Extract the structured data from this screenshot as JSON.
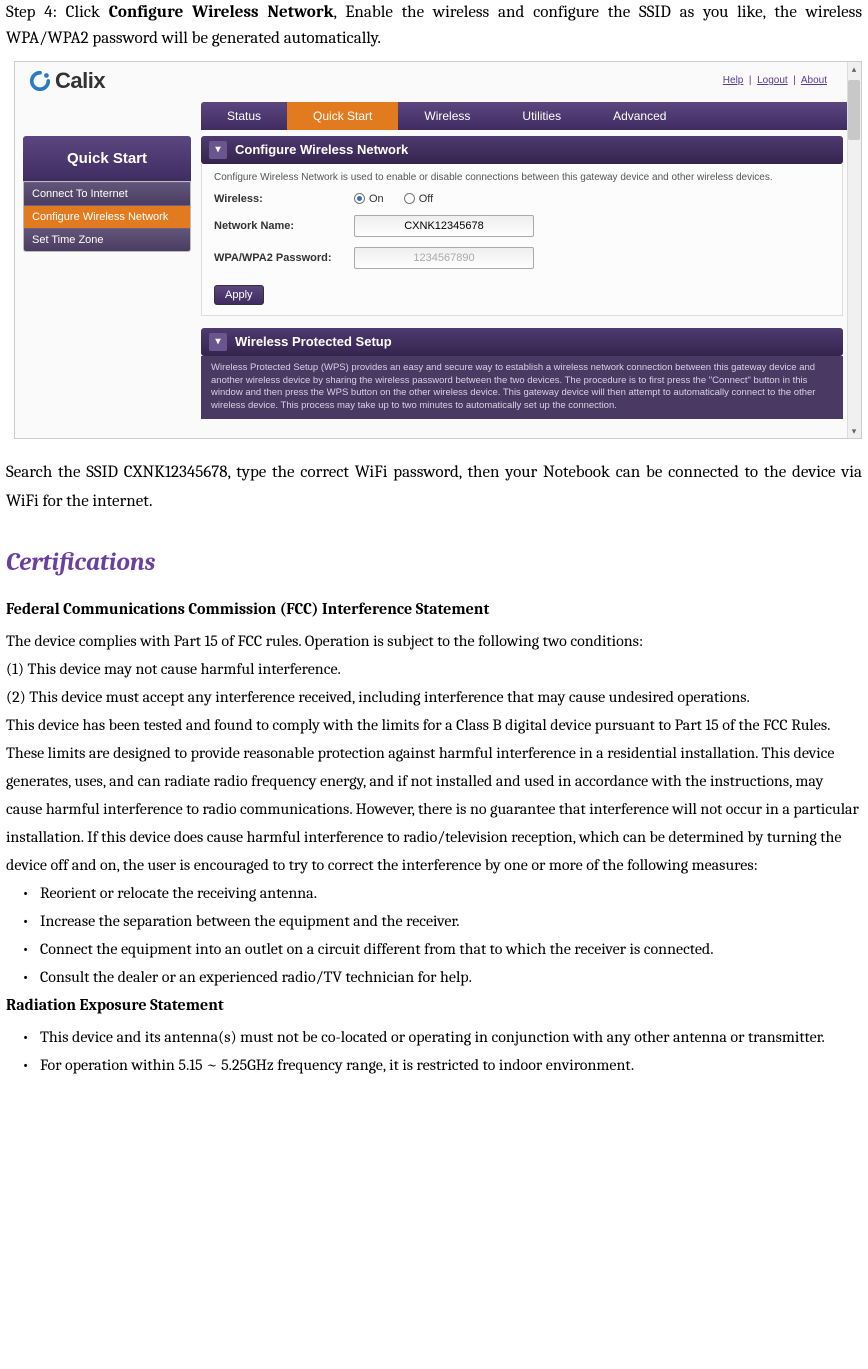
{
  "doc": {
    "step_prefix": "Step 4: Click ",
    "step_bold": "Configure Wireless Network",
    "step_suffix": ", Enable the wireless and configure the SSID as you like, the wireless WPA/WPA2 password will be generated automatically.",
    "after_screenshot": "Search the SSID CXNK12345678, type the correct WiFi password, then your Notebook can be connected to the device via WiFi for the internet.",
    "section_title": "Certifications",
    "fcc_title": "Federal Communications Commission (FCC) Interference Statement",
    "fcc_intro": "The device complies with Part 15 of FCC rules. Operation is subject to the following two conditions:",
    "fcc_cond1": "(1) This device may not cause harmful interference.",
    "fcc_cond2": "(2) This device must accept any interference received, including interference that may cause undesired operations.",
    "fcc_body": "This device has been tested and found to comply with the limits for a Class B digital device pursuant to Part 15 of the FCC Rules. These limits are designed to provide reasonable protection against harmful interference in a residential installation. This device generates, uses, and can radiate radio frequency energy, and if not installed and used in accordance with the instructions, may cause harmful interference to radio communications. However, there is no guarantee that interference will not occur in a particular installation. If this device does cause harmful interference to radio/television reception, which can be determined by turning the device off and on, the user is encouraged to try to correct the interference by one or more of the following measures:",
    "bullets": [
      "Reorient or relocate the receiving antenna.",
      "Increase the separation between the equipment and the receiver.",
      "Connect the equipment into an outlet on a circuit different from that to which the receiver is connected.",
      "Consult the dealer or an experienced radio/TV technician for help."
    ],
    "rad_title": "Radiation Exposure Statement",
    "rad_bullets": [
      "This device and its antenna(s) must not be co-located or operating in conjunction with any other antenna or transmitter.",
      "For operation within 5.15 ~ 5.25GHz frequency range, it is restricted to indoor environment."
    ]
  },
  "ui": {
    "logo_text": "Calix",
    "toplinks": {
      "help": "Help",
      "logout": "Logout",
      "about": "About"
    },
    "nav": {
      "status": "Status",
      "quickstart": "Quick Start",
      "wireless": "Wireless",
      "utilities": "Utilities",
      "advanced": "Advanced"
    },
    "sidebar_title": "Quick Start",
    "sidebar_items": {
      "connect": "Connect To Internet",
      "configure": "Configure Wireless Network",
      "timezone": "Set Time Zone"
    },
    "panel1_title": "Configure Wireless Network",
    "panel1_desc": "Configure Wireless Network is used to enable or disable connections between this gateway device and other wireless devices.",
    "form": {
      "wireless_label": "Wireless:",
      "on": "On",
      "off": "Off",
      "name_label": "Network Name:",
      "name_value": "CXNK12345678",
      "pw_label": "WPA/WPA2 Password:",
      "pw_value": "1234567890",
      "apply": "Apply"
    },
    "panel2_title": "Wireless Protected Setup",
    "panel2_desc": "Wireless Protected Setup (WPS) provides an easy and secure way to establish a wireless network connection between this gateway device and another wireless device by sharing the wireless password between the two devices.  The procedure is to first press the \"Connect\" button in this window and then press the WPS button on the other wireless device.  This gateway device will then attempt to automatically connect to the other wireless device.  This process may take up to two minutes to automatically set up the connection."
  }
}
